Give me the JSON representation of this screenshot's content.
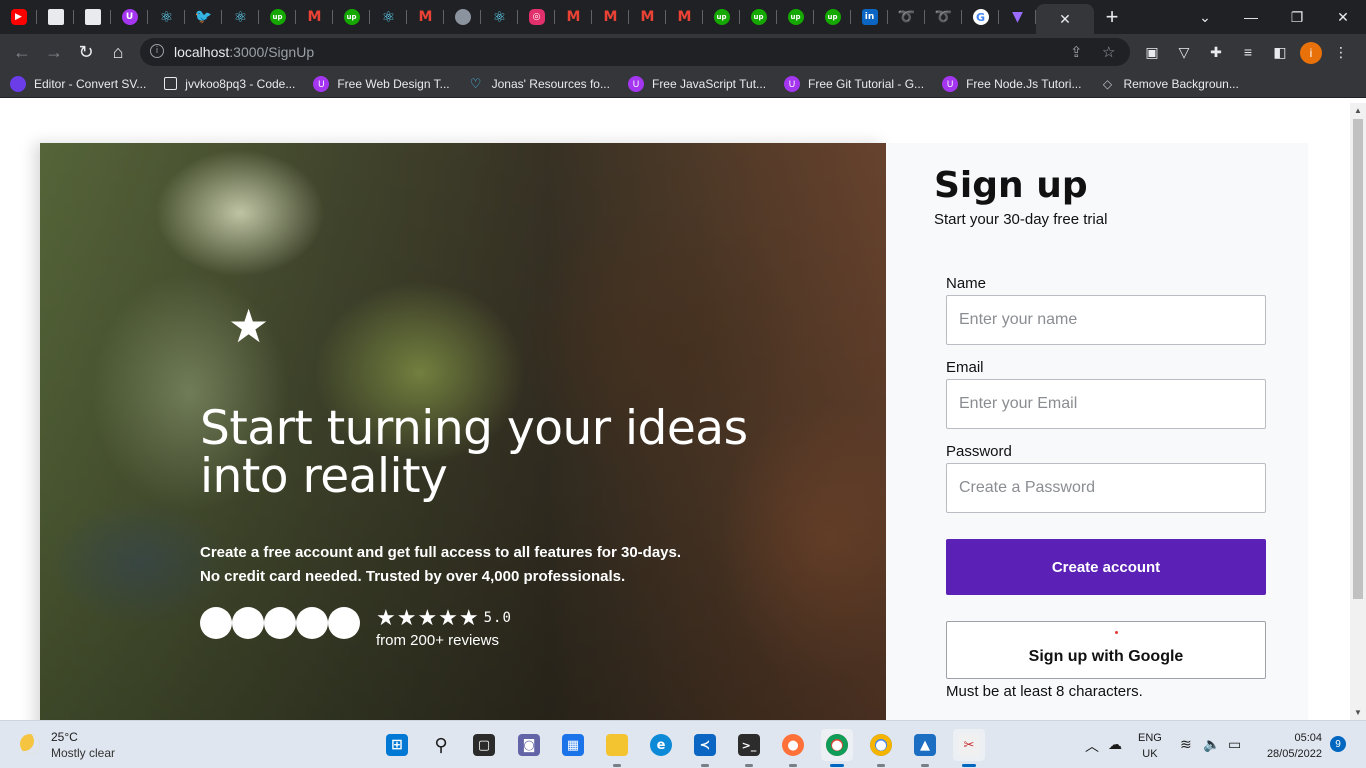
{
  "browser": {
    "tabs": [
      {
        "icon": "youtube-icon",
        "cls": "yt",
        "glyph": "▶"
      },
      {
        "icon": "document-icon",
        "cls": "doc",
        "glyph": ""
      },
      {
        "icon": "document-icon",
        "cls": "doc",
        "glyph": ""
      },
      {
        "icon": "udemy-icon",
        "cls": "udemy",
        "glyph": "U"
      },
      {
        "icon": "react-icon",
        "cls": "react",
        "glyph": "⚛"
      },
      {
        "icon": "twitter-icon",
        "cls": "tw",
        "glyph": "🐦"
      },
      {
        "icon": "react-icon",
        "cls": "react",
        "glyph": "⚛"
      },
      {
        "icon": "upwork-icon",
        "cls": "up",
        "glyph": "up"
      },
      {
        "icon": "gmail-icon",
        "cls": "gm",
        "glyph": "M"
      },
      {
        "icon": "upwork-icon",
        "cls": "up",
        "glyph": "up"
      },
      {
        "icon": "react-icon",
        "cls": "react",
        "glyph": "⚛"
      },
      {
        "icon": "gmail-icon",
        "cls": "gm",
        "glyph": "M"
      },
      {
        "icon": "github-icon",
        "cls": "gh",
        "glyph": ""
      },
      {
        "icon": "react-icon",
        "cls": "react",
        "glyph": "⚛"
      },
      {
        "icon": "instagram-icon",
        "cls": "ig",
        "glyph": "◎"
      },
      {
        "icon": "gmail-icon",
        "cls": "gm",
        "glyph": "M"
      },
      {
        "icon": "gmail-icon",
        "cls": "gm",
        "glyph": "M"
      },
      {
        "icon": "gmail-icon",
        "cls": "gm",
        "glyph": "M"
      },
      {
        "icon": "gmail-icon",
        "cls": "gm",
        "glyph": "M"
      },
      {
        "icon": "upwork-icon",
        "cls": "up",
        "glyph": "up"
      },
      {
        "icon": "upwork-icon",
        "cls": "up",
        "glyph": "up"
      },
      {
        "icon": "upwork-icon",
        "cls": "up",
        "glyph": "up"
      },
      {
        "icon": "upwork-icon",
        "cls": "up",
        "glyph": "up"
      },
      {
        "icon": "linkedin-icon",
        "cls": "li",
        "glyph": "in"
      },
      {
        "icon": "airtel-icon",
        "cls": "red",
        "glyph": "➰"
      },
      {
        "icon": "airtel-icon",
        "cls": "red",
        "glyph": "➰"
      },
      {
        "icon": "google-icon",
        "cls": "g",
        "glyph": "G"
      },
      {
        "icon": "vite-icon",
        "cls": "tri",
        "glyph": "▼"
      }
    ],
    "active_tab_close": "✕",
    "new_tab": "+",
    "url_host": "localhost",
    "url_path": ":3000/SignUp",
    "profile_initial": "i",
    "bookmarks": [
      {
        "label": "Editor - Convert SV...",
        "icon": "purple",
        "name": "editor-bookmark-icon"
      },
      {
        "label": "jvvkoo8pq3 - Code...",
        "icon": "box",
        "name": "codesandbox-bookmark-icon"
      },
      {
        "label": "Free Web Design T...",
        "icon": "udemy",
        "name": "udemy-bookmark-icon"
      },
      {
        "label": "Jonas' Resources fo...",
        "icon": "heart",
        "name": "heart-bookmark-icon"
      },
      {
        "label": "Free JavaScript Tut...",
        "icon": "udemy",
        "name": "udemy-bookmark-icon"
      },
      {
        "label": "Free Git Tutorial - G...",
        "icon": "udemy",
        "name": "udemy-bookmark-icon"
      },
      {
        "label": "Free Node.Js Tutori...",
        "icon": "udemy",
        "name": "udemy-bookmark-icon"
      },
      {
        "label": "Remove Backgroun...",
        "icon": "layer",
        "name": "layers-bookmark-icon"
      }
    ]
  },
  "hero": {
    "title": "Start turning your ideas into reality",
    "description_line1": "Create a free account and get full access to all features for 30-days.",
    "description_line2": "No credit card needed. Trusted by over 4,000 professionals.",
    "stars": "★★★★★",
    "score": "5.0",
    "reviews": "from 200+ reviews",
    "avatar_count": 5
  },
  "signup": {
    "title": "Sign up",
    "subtitle": "Start your 30-day free trial",
    "name_label": "Name",
    "name_placeholder": "Enter your name",
    "email_label": "Email",
    "email_placeholder": "Enter your Email",
    "password_label": "Password",
    "password_placeholder": "Create a Password",
    "create_button": "Create account",
    "google_button": "Sign up with Google",
    "hint": "Must be at least 8 characters."
  },
  "taskbar": {
    "temperature": "25°C",
    "condition": "Mostly clear",
    "language": "ENG",
    "region": "UK",
    "time": "05:04",
    "date": "28/05/2022",
    "notifications": "9"
  },
  "colors": {
    "primary_button": "#5b21b6",
    "panel_background": "#f8f9fb",
    "browser_dark": "#202124"
  }
}
